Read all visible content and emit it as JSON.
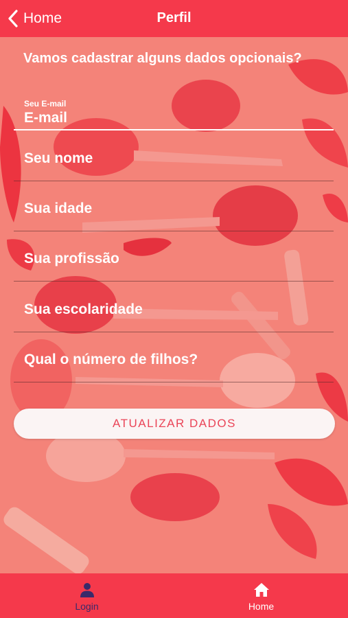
{
  "header": {
    "back_label": "Home",
    "title": "Perfil"
  },
  "form": {
    "intro": "Vamos cadastrar alguns dados opcionais?",
    "email_label": "Seu E-mail",
    "email_placeholder": "E-mail",
    "name_placeholder": "Seu nome",
    "age_placeholder": "Sua idade",
    "profession_placeholder": "Sua profissão",
    "education_placeholder": "Sua escolaridade",
    "children_placeholder": "Qual o número de filhos?",
    "submit_label": "ATUALIZAR DADOS"
  },
  "tabbar": {
    "login_label": "Login",
    "home_label": "Home"
  },
  "colors": {
    "primary": "#f5394b",
    "overlay": "#f48379",
    "button_text": "#ea4457",
    "active_tab": "#3a2a6a"
  },
  "icons": {
    "back": "chevron-left-icon",
    "login": "user-icon",
    "home": "home-icon"
  }
}
